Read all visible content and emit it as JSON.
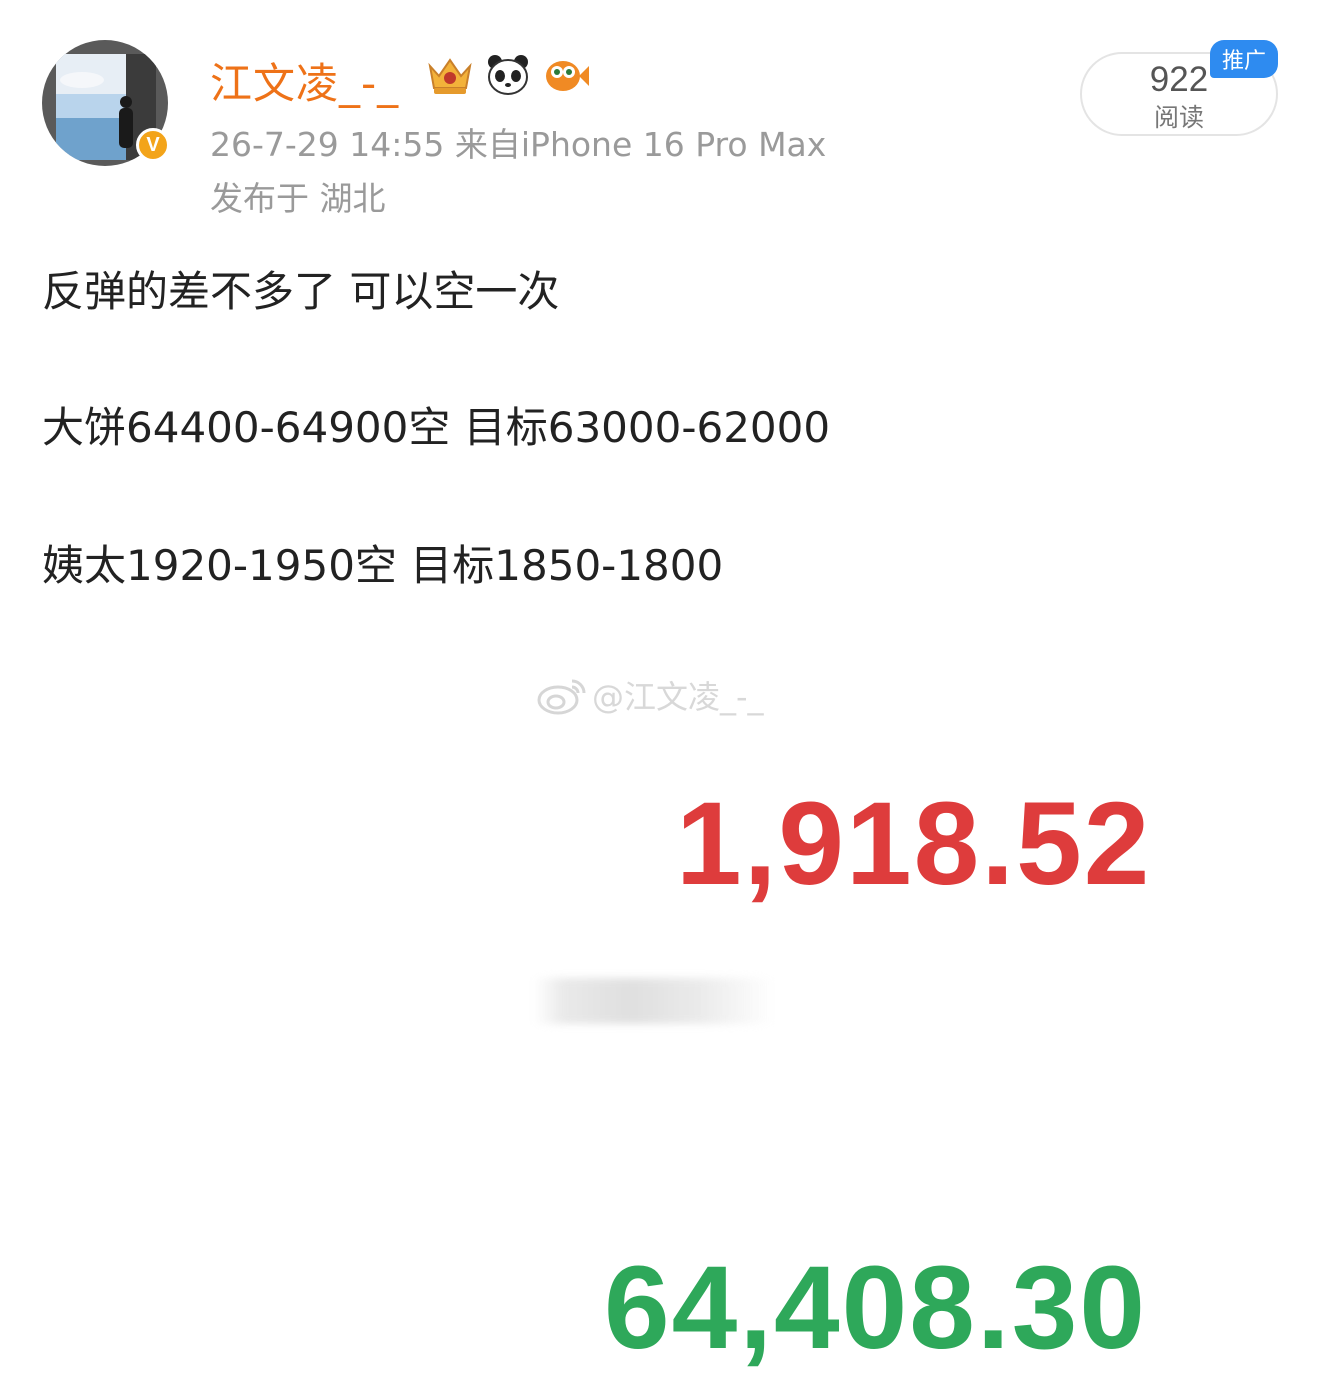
{
  "user": {
    "name": "江文凌_-_",
    "badges": [
      "crown-badge-icon",
      "panda-icon",
      "goldfish-icon"
    ],
    "verified_mark": "V"
  },
  "meta": {
    "time_source": "26-7-29 14:55  来自iPhone 16 Pro Max",
    "location": "发布于 湖北"
  },
  "reads": {
    "count": "922",
    "label": "阅读",
    "ad_tag": "推广"
  },
  "post": {
    "lines": [
      "反弹的差不多了 可以空一次",
      "大饼64400-64900空 目标63000-62000",
      "姨太1920-1950空 目标1850-1800"
    ]
  },
  "image": {
    "watermark": "@江文凌_-_",
    "eth_price": "1,918.52",
    "btc_price": "64,408.30",
    "colors": {
      "down": "#de3c3c",
      "up": "#2ea85a"
    }
  },
  "colors": {
    "username": "#ee7218",
    "meta": "#9a9a9a",
    "ad_tag": "#2e8bf0"
  }
}
